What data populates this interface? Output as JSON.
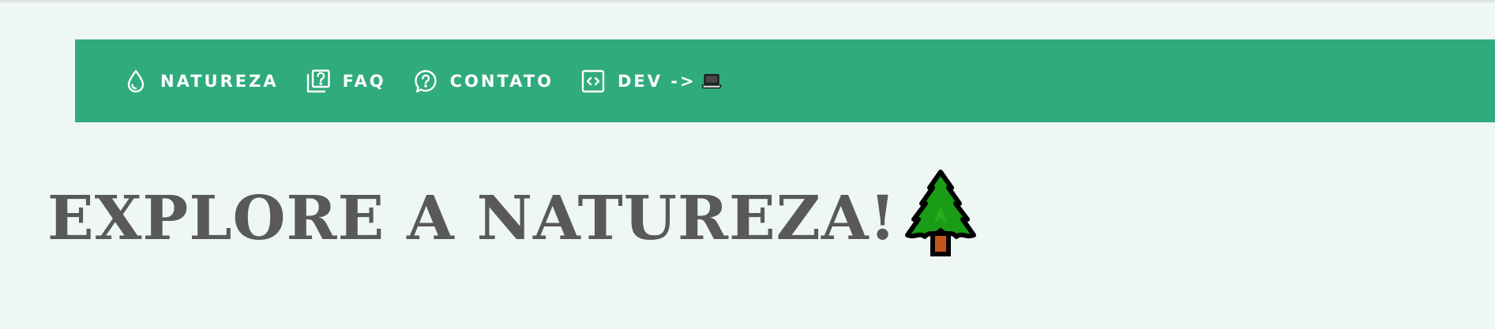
{
  "nav": {
    "items": [
      {
        "label": "NATUREZA",
        "icon": "water-drop-icon"
      },
      {
        "label": "FAQ",
        "icon": "question-stack-icon"
      },
      {
        "label": "CONTATO",
        "icon": "help-bubble-icon"
      },
      {
        "label": "DEV ->",
        "icon": "code-box-icon",
        "suffix_icon": "laptop-icon"
      }
    ]
  },
  "hero": {
    "title": "EXPLORE A NATUREZA!",
    "icon": "evergreen-tree-icon"
  },
  "colors": {
    "background": "#eef7f3",
    "navbar": "#30ab7e",
    "nav_text": "#ffffff",
    "title_text": "#595959",
    "tree_green": "#1a9c16",
    "tree_trunk": "#c4561a"
  }
}
